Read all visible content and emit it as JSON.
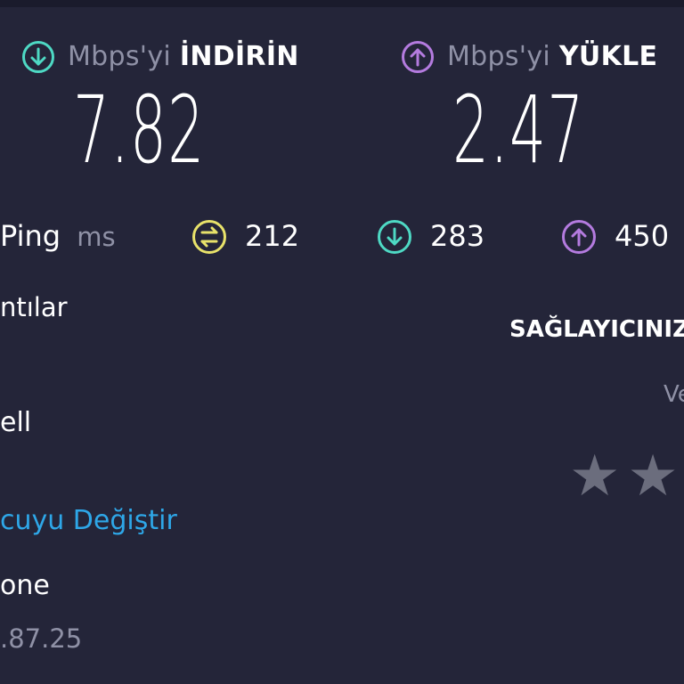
{
  "download": {
    "unit_label": "Mbps'yi",
    "direction_label": "İNDİRİN",
    "value": "7.82",
    "icon": "arrow-down-circle-icon",
    "color": "#4ed9c4"
  },
  "upload": {
    "unit_label": "Mbps'yi",
    "direction_label": "YÜKLE",
    "value": "2.47",
    "icon": "arrow-up-circle-icon",
    "color": "#b47bdf"
  },
  "ping": {
    "label": "Ping",
    "unit": "ms",
    "idle_icon": "swap-circle-icon",
    "idle_color": "#e8e26a",
    "idle_value": "212",
    "download_value": "283",
    "upload_value": "450"
  },
  "connections": {
    "heading_partial": "ntılar",
    "provider_partial": "ell",
    "change_server_partial": "cuyu Değiştir",
    "server_partial": "one",
    "ip_partial": ".87.25"
  },
  "provider_rating": {
    "heading_partial": "SAĞLAYICINIZ",
    "sub_partial": "Ve",
    "star_icon": "star-icon"
  }
}
